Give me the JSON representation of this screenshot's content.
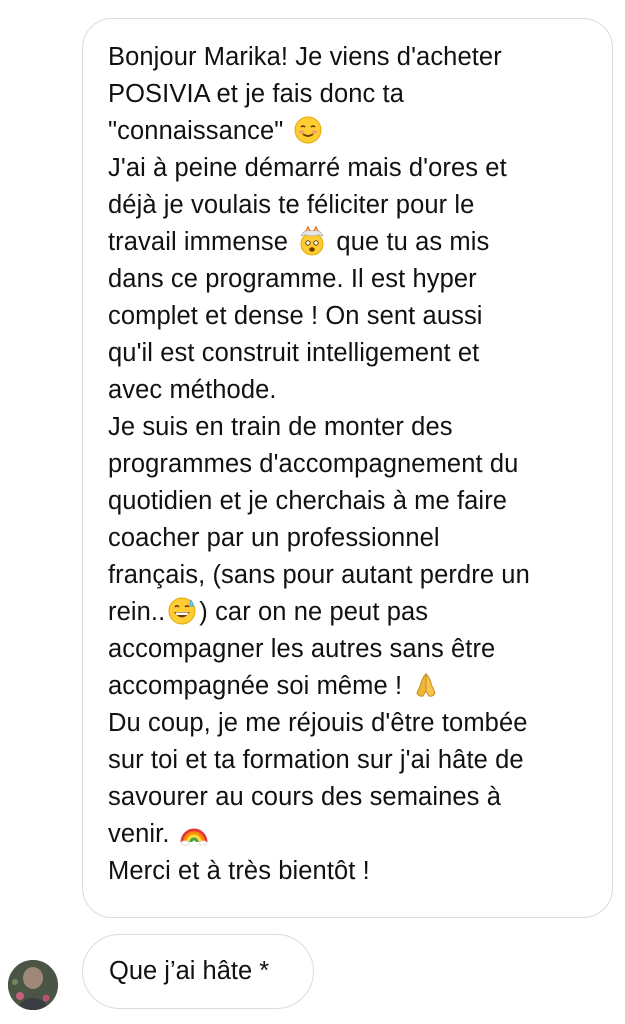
{
  "conversation": {
    "incoming_message": {
      "lines": [
        {
          "segments": [
            {
              "text": "Bonjour Marika! Je viens d'acheter"
            }
          ]
        },
        {
          "segments": [
            {
              "text": "POSIVIA et je fais donc ta"
            }
          ]
        },
        {
          "segments": [
            {
              "text": "\"connaissance\" "
            },
            {
              "emoji": "smiling-face-icon"
            }
          ]
        },
        {
          "segments": [
            {
              "text": "J'ai à peine démarré mais d'ores et"
            }
          ]
        },
        {
          "segments": [
            {
              "text": "déjà je voulais te féliciter pour le"
            }
          ]
        },
        {
          "segments": [
            {
              "text": "travail immense "
            },
            {
              "emoji": "exploding-head-icon"
            },
            {
              "text": " que tu as mis"
            }
          ]
        },
        {
          "segments": [
            {
              "text": "dans ce programme. Il est hyper"
            }
          ]
        },
        {
          "segments": [
            {
              "text": "complet et dense ! On sent aussi"
            }
          ]
        },
        {
          "segments": [
            {
              "text": "qu'il est construit intelligement et"
            }
          ]
        },
        {
          "segments": [
            {
              "text": "avec méthode."
            }
          ]
        },
        {
          "segments": [
            {
              "text": "Je suis en train de monter des"
            }
          ]
        },
        {
          "segments": [
            {
              "text": "programmes d'accompagnement du"
            }
          ]
        },
        {
          "segments": [
            {
              "text": "quotidien et je cherchais à me faire"
            }
          ]
        },
        {
          "segments": [
            {
              "text": "coacher par un professionnel"
            }
          ]
        },
        {
          "segments": [
            {
              "text": "français, (sans pour autant perdre un"
            }
          ]
        },
        {
          "segments": [
            {
              "text": "rein.."
            },
            {
              "emoji": "grinning-sweat-icon"
            },
            {
              "text": ") car on ne peut pas"
            }
          ]
        },
        {
          "segments": [
            {
              "text": "accompagner les autres sans être"
            }
          ]
        },
        {
          "segments": [
            {
              "text": "accompagnée soi même ! "
            },
            {
              "emoji": "folded-hands-icon"
            }
          ]
        },
        {
          "segments": [
            {
              "text": "Du coup, je me réjouis d'être tombée"
            }
          ]
        },
        {
          "segments": [
            {
              "text": "sur toi et ta formation sur j'ai hâte de"
            }
          ]
        },
        {
          "segments": [
            {
              "text": "savourer au cours des semaines à"
            }
          ]
        },
        {
          "segments": [
            {
              "text": "venir. "
            },
            {
              "emoji": "rainbow-icon"
            }
          ]
        },
        {
          "segments": [
            {
              "text": "Merci et à très bientôt !"
            }
          ]
        }
      ]
    },
    "reply_message": {
      "text": "Que j’ai hâte *"
    },
    "sender_avatar": {
      "icon": "profile-photo"
    }
  }
}
